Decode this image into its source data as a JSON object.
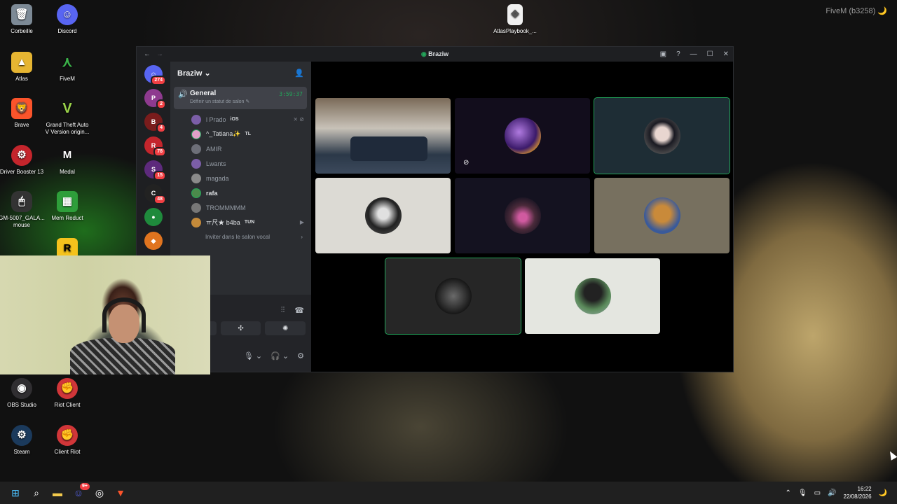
{
  "desktop": {
    "watermark": "FiveM (b3258) 🌙",
    "icons": [
      {
        "label": "Corbeille",
        "icon": "recycle-bin-icon"
      },
      {
        "label": "Discord",
        "icon": "discord-icon"
      },
      {
        "label": "Atlas",
        "icon": "folder-icon"
      },
      {
        "label": "FiveM",
        "icon": "fivem-icon"
      },
      {
        "label": "Brave",
        "icon": "brave-icon"
      },
      {
        "label": "Grand Theft Auto V Version origin...",
        "icon": "gta-icon"
      },
      {
        "label": "Driver Booster 13",
        "icon": "driver-booster-icon"
      },
      {
        "label": "Medal",
        "icon": "medal-icon"
      },
      {
        "label": "GM-5007_GALA... mouse",
        "icon": "mouse-icon"
      },
      {
        "label": "Mem Reduct",
        "icon": "mem-reduct-icon"
      },
      {
        "label": "OBS Studio",
        "icon": "obs-icon"
      },
      {
        "label": "Riot Client",
        "icon": "riot-icon"
      },
      {
        "label": "Steam",
        "icon": "steam-icon"
      },
      {
        "label": "Client Riot",
        "icon": "riot-icon"
      },
      {
        "label": "AtlasPlaybook_...",
        "icon": "file-icon"
      }
    ]
  },
  "window": {
    "title": "Braziw",
    "server_name": "Braziw",
    "guild_badges": [
      "274",
      "2",
      "4",
      "78",
      "15",
      "48"
    ],
    "voice_channel": {
      "name": "General",
      "timer": "3:59:37",
      "status": "Définir un statut de salon"
    },
    "members": [
      {
        "name": "l Prado",
        "tag": "iOS",
        "color": "#7b5ea7"
      },
      {
        "name": "^_Tatiana✨",
        "tag": "TL",
        "color": "#e0a0c8"
      },
      {
        "name": "AMIR",
        "tag": "",
        "color": "#6d6f78"
      },
      {
        "name": "Lwants",
        "tag": "",
        "color": "#7b5ea7"
      },
      {
        "name": "magada",
        "tag": "",
        "color": "#8a8a8a"
      },
      {
        "name": "rafa",
        "tag": "",
        "color": "#4b8a4b"
      },
      {
        "name": "TROMMMMM",
        "tag": "",
        "color": "#777"
      },
      {
        "name": "ㅠ尺★ b4ba",
        "tag": "TUN",
        "color": "#c48a3a"
      }
    ],
    "invite_label": "Inviter dans le salon vocal"
  },
  "taskbar": {
    "time": "16:22",
    "date": "22/08/2026",
    "discord_badge": "9+"
  },
  "colors": {
    "accent_green": "#23a55a",
    "discord_blurple": "#5865f2",
    "badge_red": "#f23f43"
  }
}
